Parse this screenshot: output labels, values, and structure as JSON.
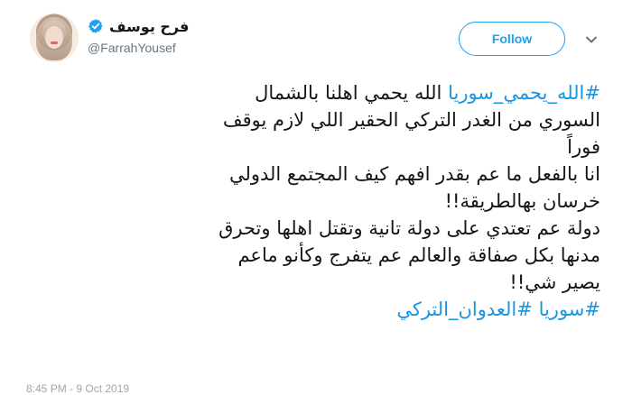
{
  "profile": {
    "display_name": "فرح يوسف",
    "username": "@FarrahYousef",
    "verified": true
  },
  "actions": {
    "follow_label": "Follow",
    "caret_icon": "chevron-down-icon"
  },
  "tweet": {
    "line_1": {
      "hashtag": "#الله_يحمي_سوريا",
      "text": " الله يحمي اهلنا بالشمال"
    },
    "line_2": "السوري من الغدر التركي الحقير اللي لازم يوقف",
    "line_3": "فوراً",
    "line_4": "انا بالفعل ما عم بقدر افهم كيف المجتمع الدولي",
    "line_5": "خرسان بهالطريقة!!",
    "line_6": "دولة عم تعتدي على دولة تانية وتقتل اهلها وتحرق",
    "line_7": "مدنها بكل صفاقة والعالم عم يتفرج وكأنو ماعم",
    "line_8": "يصير شي!!",
    "line_9": {
      "hashtag_1": "#سوريا",
      "hashtag_2": "#العدوان_التركي"
    }
  },
  "meta": {
    "timestamp_partial": "8:45 PM - 9 Oct 2019"
  },
  "colors": {
    "link_blue": "#1b95e0",
    "follow_blue": "#1da1f2",
    "text_primary": "#14171a",
    "text_secondary": "#657786"
  }
}
